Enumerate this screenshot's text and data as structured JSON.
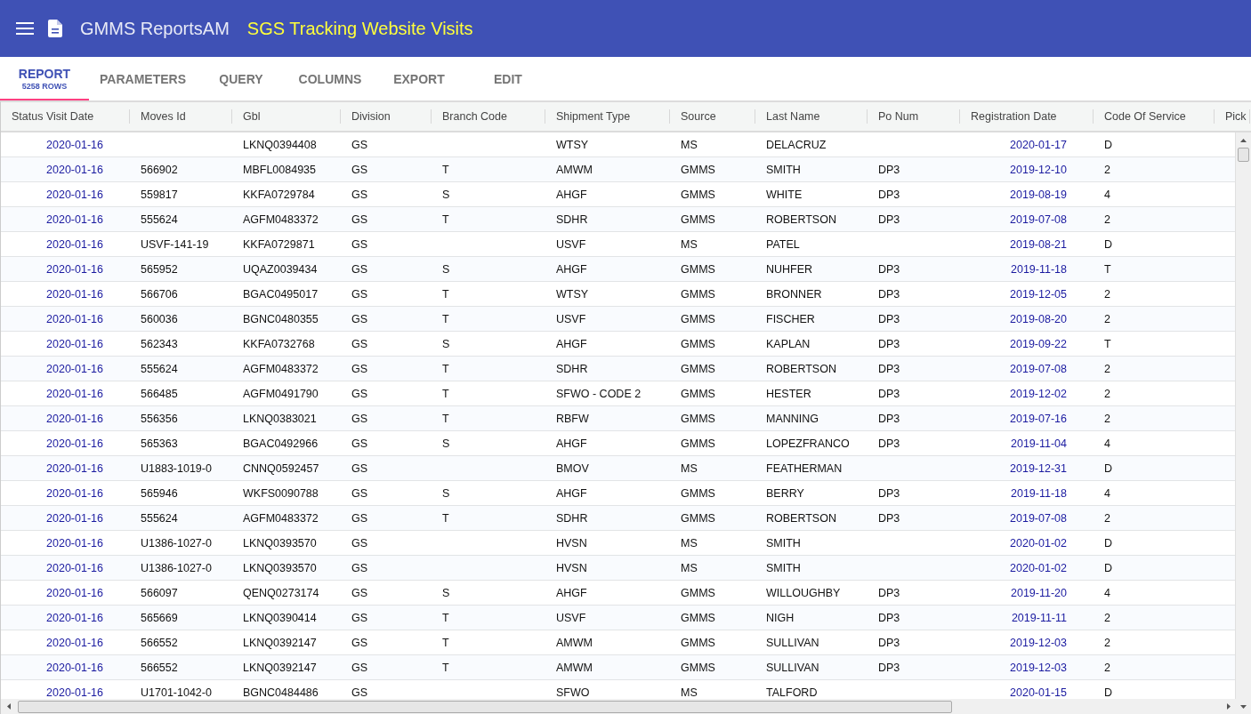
{
  "app_bar": {
    "title": "GMMS ReportsAM",
    "report_title": "SGS Tracking Website Visits"
  },
  "tabs": [
    {
      "label": "REPORT",
      "sublabel": "5258 ROWS",
      "selected": true
    },
    {
      "label": "PARAMETERS",
      "selected": false
    },
    {
      "label": "QUERY",
      "selected": false
    },
    {
      "label": "COLUMNS",
      "selected": false
    },
    {
      "label": "EXPORT",
      "selected": false
    },
    {
      "label": "EDIT",
      "selected": false
    }
  ],
  "table": {
    "columns": [
      {
        "label": "Status Visit Date",
        "kind": "date"
      },
      {
        "label": "Moves Id",
        "kind": "text"
      },
      {
        "label": "Gbl",
        "kind": "text"
      },
      {
        "label": "Division",
        "kind": "text"
      },
      {
        "label": "Branch Code",
        "kind": "text"
      },
      {
        "label": "Shipment Type",
        "kind": "text"
      },
      {
        "label": "Source",
        "kind": "text"
      },
      {
        "label": "Last Name",
        "kind": "text"
      },
      {
        "label": "Po Num",
        "kind": "text"
      },
      {
        "label": "Registration Date",
        "kind": "date"
      },
      {
        "label": "Code Of Service",
        "kind": "text"
      },
      {
        "label": "Pick",
        "kind": "text"
      }
    ],
    "rows": [
      [
        "2020-01-16",
        "",
        "LKNQ0394408",
        "GS",
        "",
        "WTSY",
        "MS",
        "DELACRUZ",
        "",
        "2020-01-17",
        "D"
      ],
      [
        "2020-01-16",
        "566902",
        "MBFL0084935",
        "GS",
        "T",
        "AMWM",
        "GMMS",
        "SMITH",
        "DP3",
        "2019-12-10",
        "2"
      ],
      [
        "2020-01-16",
        "559817",
        "KKFA0729784",
        "GS",
        "S",
        "AHGF",
        "GMMS",
        "WHITE",
        "DP3",
        "2019-08-19",
        "4"
      ],
      [
        "2020-01-16",
        "555624",
        "AGFM0483372",
        "GS",
        "T",
        "SDHR",
        "GMMS",
        "ROBERTSON",
        "DP3",
        "2019-07-08",
        "2"
      ],
      [
        "2020-01-16",
        "USVF-141-19",
        "KKFA0729871",
        "GS",
        "",
        "USVF",
        "MS",
        "PATEL",
        "",
        "2019-08-21",
        "D"
      ],
      [
        "2020-01-16",
        "565952",
        "UQAZ0039434",
        "GS",
        "S",
        "AHGF",
        "GMMS",
        "NUHFER",
        "DP3",
        "2019-11-18",
        "T"
      ],
      [
        "2020-01-16",
        "566706",
        "BGAC0495017",
        "GS",
        "T",
        "WTSY",
        "GMMS",
        "BRONNER",
        "DP3",
        "2019-12-05",
        "2"
      ],
      [
        "2020-01-16",
        "560036",
        "BGNC0480355",
        "GS",
        "T",
        "USVF",
        "GMMS",
        "FISCHER",
        "DP3",
        "2019-08-20",
        "2"
      ],
      [
        "2020-01-16",
        "562343",
        "KKFA0732768",
        "GS",
        "S",
        "AHGF",
        "GMMS",
        "KAPLAN",
        "DP3",
        "2019-09-22",
        "T"
      ],
      [
        "2020-01-16",
        "555624",
        "AGFM0483372",
        "GS",
        "T",
        "SDHR",
        "GMMS",
        "ROBERTSON",
        "DP3",
        "2019-07-08",
        "2"
      ],
      [
        "2020-01-16",
        "566485",
        "AGFM0491790",
        "GS",
        "T",
        "SFWO - CODE 2",
        "GMMS",
        "HESTER",
        "DP3",
        "2019-12-02",
        "2"
      ],
      [
        "2020-01-16",
        "556356",
        "LKNQ0383021",
        "GS",
        "T",
        "RBFW",
        "GMMS",
        "MANNING",
        "DP3",
        "2019-07-16",
        "2"
      ],
      [
        "2020-01-16",
        "565363",
        "BGAC0492966",
        "GS",
        "S",
        "AHGF",
        "GMMS",
        "LOPEZFRANCO",
        "DP3",
        "2019-11-04",
        "4"
      ],
      [
        "2020-01-16",
        "U1883-1019-0",
        "CNNQ0592457",
        "GS",
        "",
        "BMOV",
        "MS",
        "FEATHERMAN",
        "",
        "2019-12-31",
        "D"
      ],
      [
        "2020-01-16",
        "565946",
        "WKFS0090788",
        "GS",
        "S",
        "AHGF",
        "GMMS",
        "BERRY",
        "DP3",
        "2019-11-18",
        "4"
      ],
      [
        "2020-01-16",
        "555624",
        "AGFM0483372",
        "GS",
        "T",
        "SDHR",
        "GMMS",
        "ROBERTSON",
        "DP3",
        "2019-07-08",
        "2"
      ],
      [
        "2020-01-16",
        "U1386-1027-0",
        "LKNQ0393570",
        "GS",
        "",
        "HVSN",
        "MS",
        "SMITH",
        "",
        "2020-01-02",
        "D"
      ],
      [
        "2020-01-16",
        "U1386-1027-0",
        "LKNQ0393570",
        "GS",
        "",
        "HVSN",
        "MS",
        "SMITH",
        "",
        "2020-01-02",
        "D"
      ],
      [
        "2020-01-16",
        "566097",
        "QENQ0273174",
        "GS",
        "S",
        "AHGF",
        "GMMS",
        "WILLOUGHBY",
        "DP3",
        "2019-11-20",
        "4"
      ],
      [
        "2020-01-16",
        "565669",
        "LKNQ0390414",
        "GS",
        "T",
        "USVF",
        "GMMS",
        "NIGH",
        "DP3",
        "2019-11-11",
        "2"
      ],
      [
        "2020-01-16",
        "566552",
        "LKNQ0392147",
        "GS",
        "T",
        "AMWM",
        "GMMS",
        "SULLIVAN",
        "DP3",
        "2019-12-03",
        "2"
      ],
      [
        "2020-01-16",
        "566552",
        "LKNQ0392147",
        "GS",
        "T",
        "AMWM",
        "GMMS",
        "SULLIVAN",
        "DP3",
        "2019-12-03",
        "2"
      ],
      [
        "2020-01-16",
        "U1701-1042-0",
        "BGNC0484486",
        "GS",
        "",
        "SFWO",
        "MS",
        "TALFORD",
        "",
        "2020-01-15",
        "D"
      ]
    ]
  }
}
